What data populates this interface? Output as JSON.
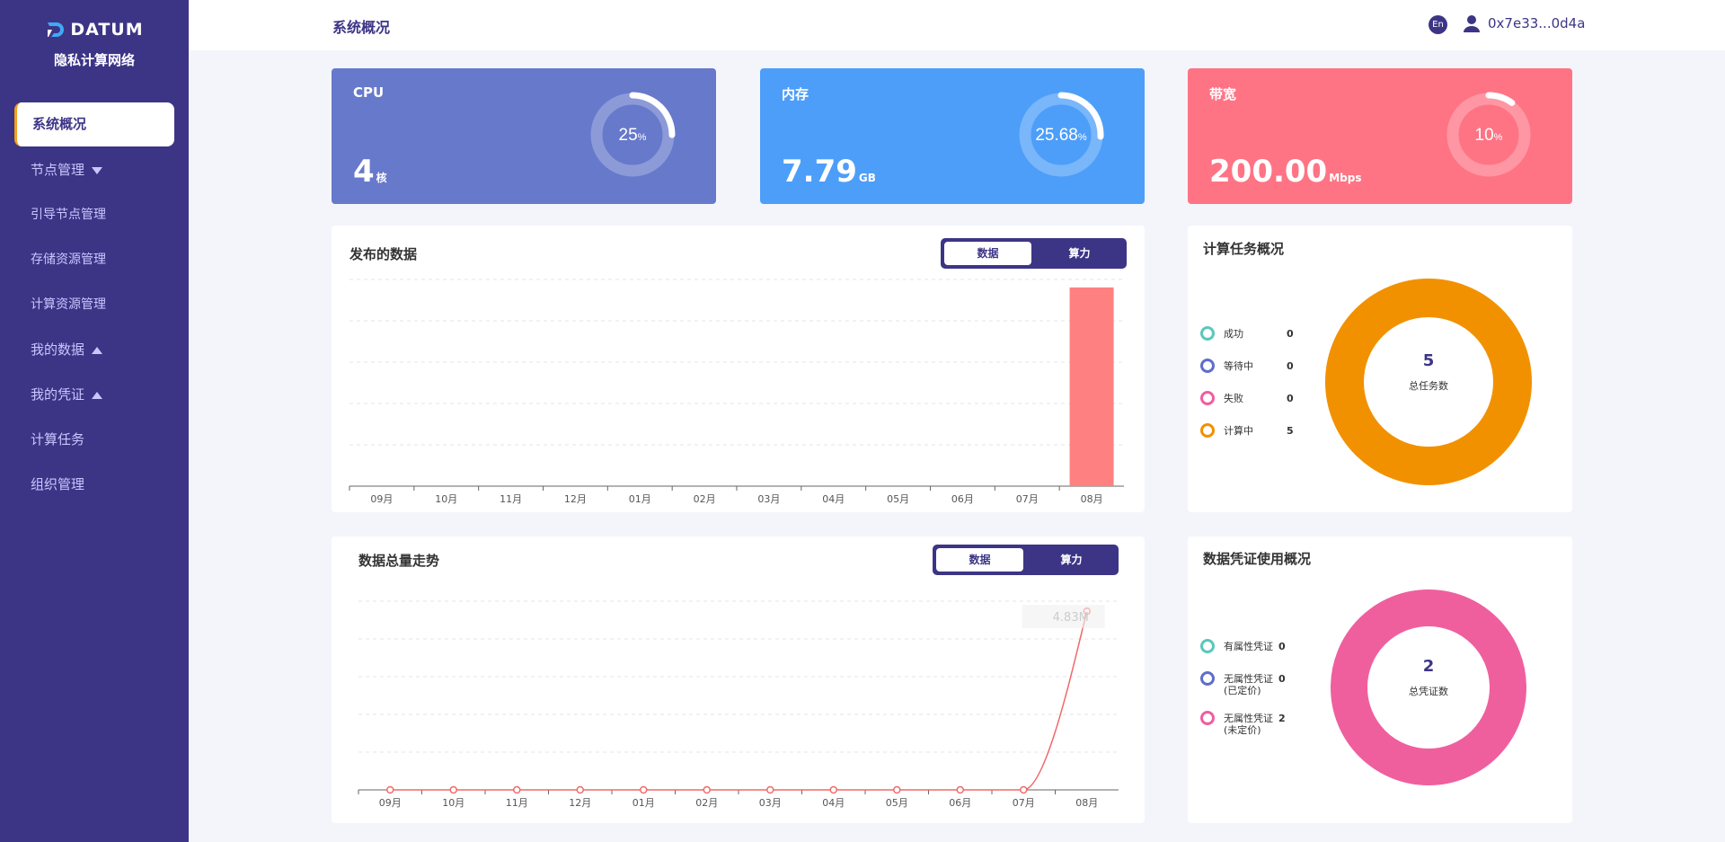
{
  "brand": {
    "name": "DATUM",
    "subtitle": "隐私计算网络"
  },
  "sidebar": {
    "items": [
      {
        "label": "系统概况",
        "active": true
      },
      {
        "label": "节点管理",
        "arrow": "down"
      },
      {
        "label": "引导节点管理",
        "sub": true
      },
      {
        "label": "存储资源管理",
        "sub": true
      },
      {
        "label": "计算资源管理",
        "sub": true
      },
      {
        "label": "我的数据",
        "arrow": "up"
      },
      {
        "label": "我的凭证",
        "arrow": "up"
      },
      {
        "label": "计算任务"
      },
      {
        "label": "组织管理"
      }
    ]
  },
  "header": {
    "title": "系统概况",
    "lang": "En",
    "user": "0x7e33...0d4a"
  },
  "cards": {
    "cpu": {
      "label": "CPU",
      "value": "4",
      "unit": "核",
      "percent_label": "25",
      "percent_sign": "%",
      "fraction": 0.25,
      "color": "#6779cb"
    },
    "memory": {
      "label": "内存",
      "value": "7.79",
      "unit": "GB",
      "percent_label": "25.68",
      "percent_sign": "%",
      "fraction": 0.2568,
      "color": "#4d9ef9"
    },
    "bandwidth": {
      "label": "带宽",
      "value": "200.00",
      "unit": "Mbps",
      "percent_label": "10",
      "percent_sign": "%",
      "fraction": 0.1,
      "color": "#fe7485"
    }
  },
  "published": {
    "title": "发布的数据",
    "toggle_on": "数据",
    "toggle_off": "算力"
  },
  "trend": {
    "title": "数据总量走势",
    "toggle_on": "数据",
    "toggle_off": "算力",
    "tooltip": "4.83M"
  },
  "tasks": {
    "title": "计算任务概况",
    "total": "5",
    "total_label": "总任务数",
    "legend": [
      {
        "label": "成功",
        "value": "0",
        "color": "#5ac8b9"
      },
      {
        "label": "等待中",
        "value": "0",
        "color": "#5f6ec8"
      },
      {
        "label": "失败",
        "value": "0",
        "color": "#ef5f9e"
      },
      {
        "label": "计算中",
        "value": "5",
        "color": "#f29100"
      }
    ]
  },
  "credentials": {
    "title": "数据凭证使用概况",
    "total": "2",
    "total_label": "总凭证数",
    "legend": [
      {
        "label": "有属性凭证",
        "value": "0",
        "note": "",
        "color": "#5ac8b9"
      },
      {
        "label": "无属性凭证",
        "value": "0",
        "note": "(已定价)",
        "color": "#5f6ec8"
      },
      {
        "label": "无属性凭证",
        "value": "2",
        "note": "(未定价)",
        "color": "#ef5f9e"
      }
    ]
  },
  "chart_data": [
    {
      "type": "bar",
      "categories": [
        "09月",
        "10月",
        "11月",
        "12月",
        "01月",
        "02月",
        "03月",
        "04月",
        "05月",
        "06月",
        "07月",
        "08月"
      ],
      "values": [
        0,
        0,
        0,
        0,
        0,
        0,
        0,
        0,
        0,
        0,
        0,
        1
      ],
      "color": "#ff8080",
      "ylim": [
        0,
        1.04
      ]
    },
    {
      "type": "line",
      "categories": [
        "09月",
        "10月",
        "11月",
        "12月",
        "01月",
        "02月",
        "03月",
        "04月",
        "05月",
        "06月",
        "07月",
        "08月"
      ],
      "values": [
        0,
        0,
        0,
        0,
        0,
        0,
        0,
        0,
        0,
        0,
        0,
        4.83
      ],
      "color": "#f06969",
      "ylim": [
        0,
        5
      ]
    },
    {
      "type": "pie",
      "labels": [
        "成功",
        "等待中",
        "失败",
        "计算中"
      ],
      "values": [
        0,
        0,
        0,
        5
      ],
      "colors": [
        "#5ac8b9",
        "#5f6ec8",
        "#ef5f9e",
        "#f29100"
      ]
    },
    {
      "type": "pie",
      "labels": [
        "有属性凭证",
        "无属性凭证(已定价)",
        "无属性凭证(未定价)"
      ],
      "values": [
        0,
        0,
        2
      ],
      "colors": [
        "#5ac8b9",
        "#5f6ec8",
        "#ef5f9e"
      ]
    }
  ]
}
